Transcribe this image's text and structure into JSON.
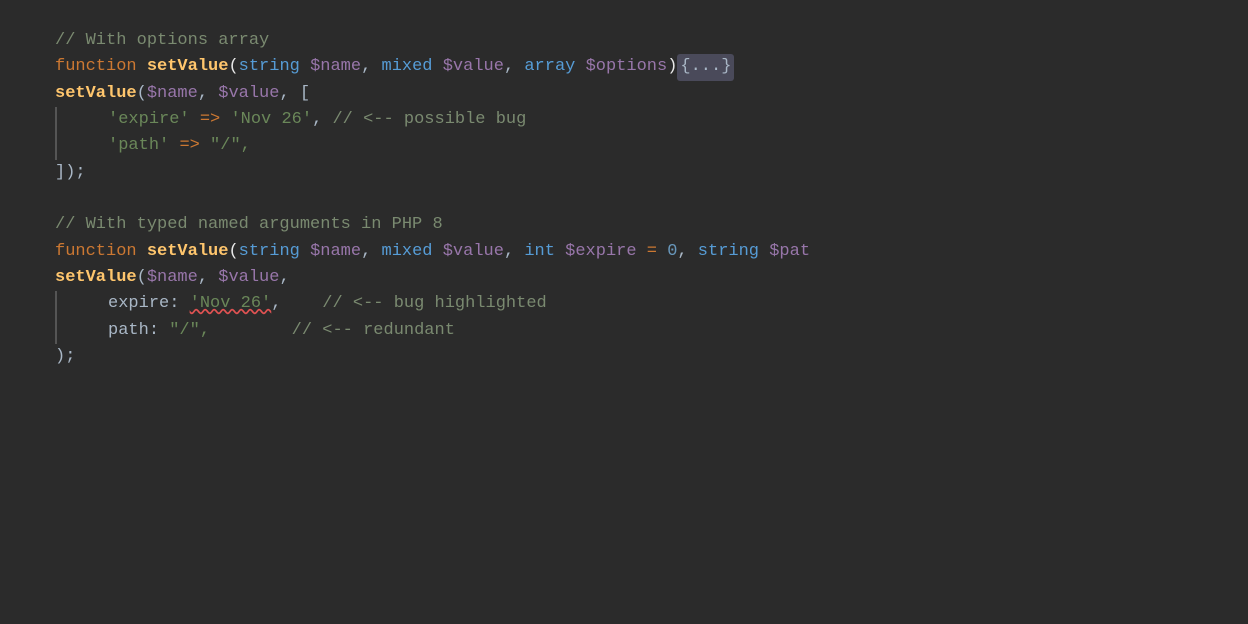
{
  "code": {
    "section1": {
      "comment": "// With options array",
      "line1_kw": "function ",
      "line1_fn": "setValue",
      "line1_params": "(string $name, mixed $value, array $options)",
      "line1_collapsed": "{...}",
      "line2": "setValue($name, $value, [",
      "line3": "    'expire' => 'Nov 26', // <-- possible bug",
      "line4": "    'path' => \"/\",",
      "line5": "]);"
    },
    "section2": {
      "comment": "// With typed named arguments in PHP 8",
      "line1_kw": "function ",
      "line1_fn": "setValue",
      "line1_params": "(string $name, mixed $value, int $expire = 0, string $pat",
      "line2": "setValue($name, $value,",
      "line3_label": "    expire: ",
      "line3_val": "'Nov 26'",
      "line3_comment": ",    // <-- bug highlighted",
      "line4_label": "    path: \"/\",",
      "line4_comment": "        // <-- redundant",
      "line5": ");"
    }
  }
}
